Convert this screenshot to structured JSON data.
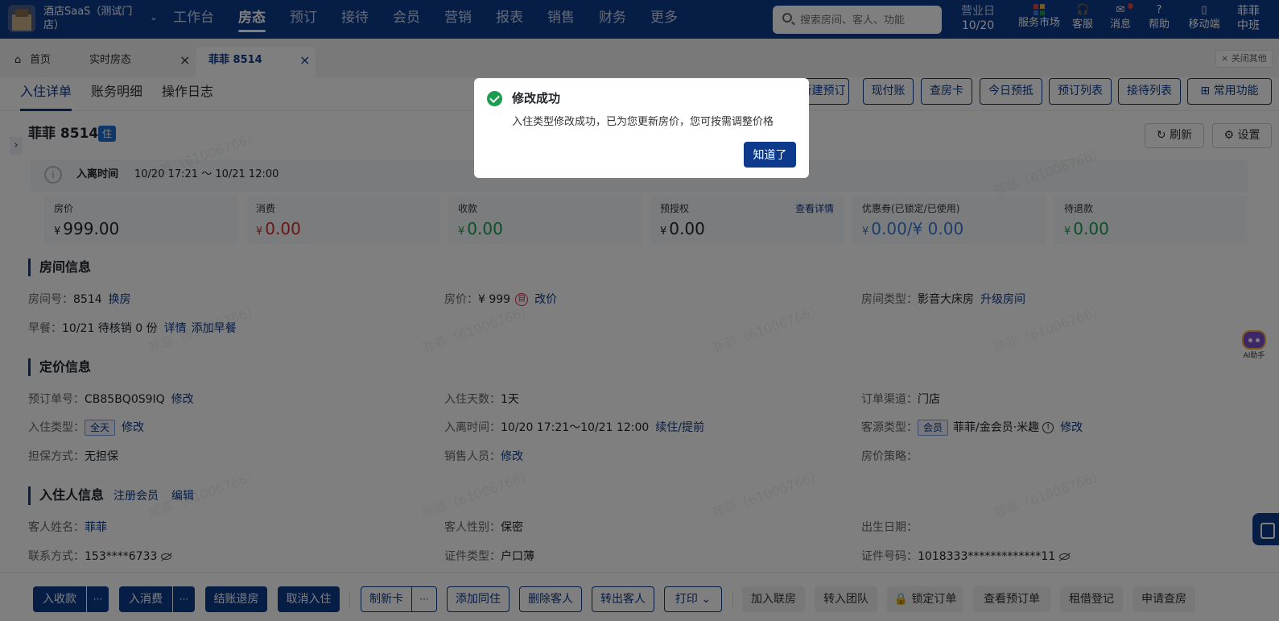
{
  "topbar": {
    "hotel_name": "酒店SaaS（测试门店）",
    "nav": [
      "工作台",
      "房态",
      "预订",
      "接待",
      "会员",
      "营销",
      "报表",
      "销售",
      "财务",
      "更多"
    ],
    "active_nav": "房态",
    "search_placeholder": "搜索房间、客人、功能",
    "business_day_label": "营业日",
    "business_day_value": "10/20",
    "tools": {
      "market": "服务市场",
      "service": "客服",
      "message": "消息",
      "help": "帮助",
      "mobile": "移动端"
    },
    "user_name": "菲菲",
    "user_shift": "中班"
  },
  "tabs": {
    "home": "首页",
    "realtime": "实时房态",
    "current": "菲菲 8514",
    "close_others": "关闭其他"
  },
  "subtabs": [
    "入住详单",
    "账务明细",
    "操作日志"
  ],
  "quick_buttons": [
    "新建预订",
    "现付账",
    "查房卡",
    "今日预抵",
    "预订列表",
    "接待列表",
    "常用功能"
  ],
  "guest_header": {
    "title": "菲菲 8514",
    "status_badge": "住",
    "refresh": "刷新",
    "settings": "设置"
  },
  "stay": {
    "label": "入离时间",
    "value": "10/20 17:21 ～ 10/21 12:00"
  },
  "money_cards": [
    {
      "label": "房价",
      "currency": "¥",
      "value": "999.00",
      "color": "#1f2329"
    },
    {
      "label": "消费",
      "currency": "¥",
      "value": "0.00",
      "color": "#d62a2a"
    },
    {
      "label": "收款",
      "currency": "¥",
      "value": "0.00",
      "color": "#1a9d4e"
    },
    {
      "label": "预授权",
      "currency": "¥",
      "value": "0.00",
      "color": "#1f2329",
      "link": "查看详情"
    },
    {
      "label": "优惠券(已锁定/已使用)",
      "currency": "¥",
      "value": "0.00/¥ 0.00",
      "color": "#3b7ad6"
    },
    {
      "label": "待退款",
      "currency": "¥",
      "value": "0.00",
      "color": "#1a9d4e"
    }
  ],
  "room_info": {
    "title": "房间信息",
    "room_no_label": "房间号：",
    "room_no": "8514",
    "change_room": "换房",
    "price_label": "房价：",
    "price": "¥ 999",
    "seal": "自",
    "change_price": "改价",
    "room_type_label": "房间类型：",
    "room_type": "影音大床房",
    "upgrade": "升级房间",
    "breakfast_label": "早餐：",
    "breakfast": "10/21 待核销 0 份",
    "breakfast_detail": "详情",
    "add_breakfast": "添加早餐"
  },
  "pricing_info": {
    "title": "定价信息",
    "order_no_label": "预订单号：",
    "order_no": "CB85BQ0S9IQ",
    "edit": "修改",
    "days_label": "入住天数：",
    "days": "1天",
    "channel_label": "订单渠道：",
    "channel": "门店",
    "checkin_type_label": "入住类型：",
    "checkin_type": "全天",
    "stay_time_label": "入离时间：",
    "stay_time": "10/20 17:21～10/21 12:00",
    "extend": "续住/提前",
    "source_label": "客源类型：",
    "source_tag": "会员",
    "source": "菲菲/金会员·米趣",
    "guarantee_label": "担保方式：",
    "guarantee": "无担保",
    "sales_label": "销售人员：",
    "policy_label": "房价策略："
  },
  "guest_info": {
    "title": "入住人信息",
    "register": "注册会员",
    "edit": "编辑",
    "name_label": "客人姓名：",
    "name": "菲菲",
    "gender_label": "客人性别：",
    "gender": "保密",
    "birth_label": "出生日期：",
    "phone_label": "联系方式：",
    "phone": "153****6733",
    "id_type_label": "证件类型：",
    "id_type": "户口薄",
    "id_no_label": "证件号码：",
    "id_no": "1018333*************11"
  },
  "bottom_buttons": {
    "collect": "入收款",
    "consume": "入消费",
    "checkout": "结账退房",
    "cancel_checkin": "取消入住",
    "make_card": "制新卡",
    "add_companion": "添加同住",
    "delete_guest": "删除客人",
    "transfer_guest": "转出客人",
    "print": "打印",
    "join_link": "加入联房",
    "to_team": "转入团队",
    "lock_order": "锁定订单",
    "view_order": "查看预订单",
    "rent_register": "租借登记",
    "apply_check": "申请查房",
    "more": "···"
  },
  "ai_label": "AI助手",
  "watermark": "菲菲（61006766）",
  "modal": {
    "title": "修改成功",
    "message": "入住类型修改成功，已为您更新房价，您可按需调整价格",
    "ok": "知道了"
  },
  "colors": {
    "brand": "#0d3a8c",
    "success": "#1a9d4e",
    "danger": "#d62a2a"
  }
}
